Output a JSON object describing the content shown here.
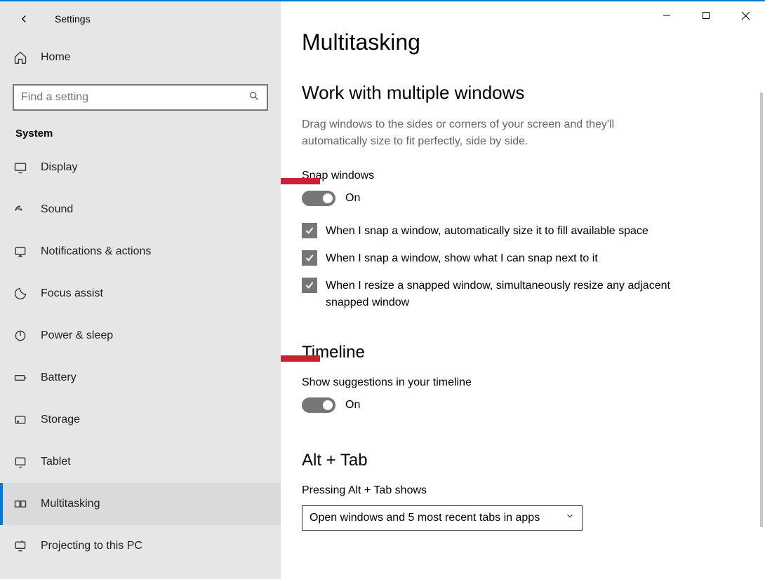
{
  "window_title": "Settings",
  "nav": {
    "home": "Home",
    "search_placeholder": "Find a setting",
    "category": "System",
    "items": [
      {
        "icon": "display",
        "label": "Display"
      },
      {
        "icon": "sound",
        "label": "Sound"
      },
      {
        "icon": "notifications",
        "label": "Notifications & actions"
      },
      {
        "icon": "focus",
        "label": "Focus assist"
      },
      {
        "icon": "power",
        "label": "Power & sleep"
      },
      {
        "icon": "battery",
        "label": "Battery"
      },
      {
        "icon": "storage",
        "label": "Storage"
      },
      {
        "icon": "tablet",
        "label": "Tablet"
      },
      {
        "icon": "multitasking",
        "label": "Multitasking",
        "active": true
      },
      {
        "icon": "projecting",
        "label": "Projecting to this PC"
      }
    ]
  },
  "page": {
    "title": "Multitasking",
    "snap": {
      "heading": "Work with multiple windows",
      "desc": "Drag windows to the sides or corners of your screen and they'll automatically size to fit perfectly, side by side.",
      "toggle_label": "Snap windows",
      "toggle_state": "On",
      "checks": [
        "When I snap a window, automatically size it to fill available space",
        "When I snap a window, show what I can snap next to it",
        "When I resize a snapped window, simultaneously resize any adjacent snapped window"
      ]
    },
    "timeline": {
      "heading": "Timeline",
      "label": "Show suggestions in your timeline",
      "toggle_state": "On"
    },
    "alttab": {
      "heading": "Alt + Tab",
      "label": "Pressing Alt + Tab shows",
      "selected": "Open windows and 5 most recent tabs in apps"
    }
  }
}
